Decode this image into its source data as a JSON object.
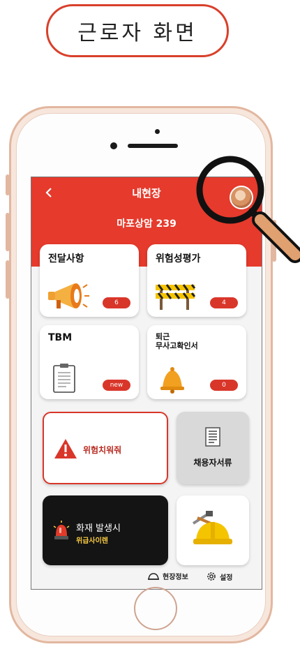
{
  "caption": "근로자 화면",
  "header": {
    "back_icon": "chevron-left-icon",
    "title": "내현장",
    "site_name": "마포상암 239"
  },
  "cards": [
    {
      "label": "전달사항",
      "badge": "6",
      "icon": "megaphone-icon"
    },
    {
      "label": "위험성평가",
      "badge": "4",
      "icon": "barricade-icon"
    },
    {
      "label": "TBM",
      "badge": "new",
      "icon": "clipboard-icon"
    },
    {
      "label": "퇴근\n무사고확인서",
      "badge": "0",
      "icon": "bell-icon"
    }
  ],
  "actions": {
    "danger_label": "위험치워줘",
    "documents_label": "채용자서류",
    "fire_label_line1": "화재 발생시",
    "fire_label_line2": "위급사이렌"
  },
  "footer": {
    "site_info_label": "현장정보",
    "settings_label": "설정"
  },
  "colors": {
    "accent": "#e53a2c",
    "badge": "#d9362a",
    "fire_card": "#141414",
    "fire_text": "#f5c842"
  }
}
